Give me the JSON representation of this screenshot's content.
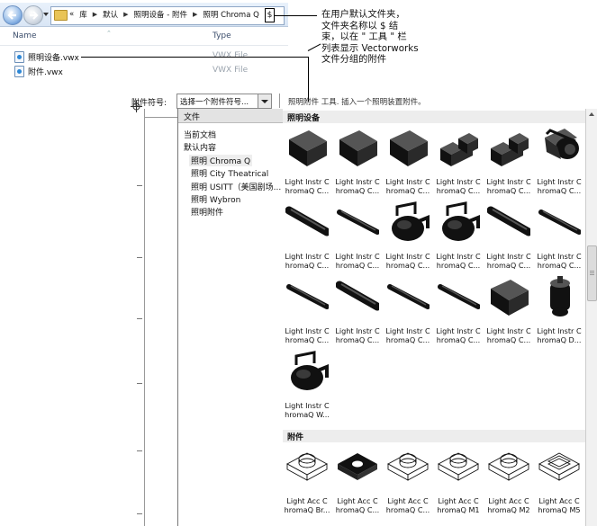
{
  "explorer": {
    "crumbs": [
      "«",
      "库",
      "默认",
      "照明设备 - 附件",
      "照明 Chroma Q"
    ],
    "columns": {
      "name": "Name",
      "type": "Type"
    },
    "files": [
      {
        "name": "照明设备.vwx",
        "type": "VWX File"
      },
      {
        "name": "附件.vwx",
        "type": "VWX File"
      }
    ]
  },
  "callout": {
    "lines": [
      "在用户默认文件夹，",
      "文件夹名称以 $ 结",
      "束，以在 \" 工具 \" 栏",
      "列表显示 Vectorworks",
      "文件分组的附件"
    ],
    "cursor_char": "$"
  },
  "toolbar": {
    "attach_label": "附件符号:",
    "select_value": "选择一个附件符号...",
    "hint": "照明附件 工具. 插入一个照明装置附件。"
  },
  "tree": {
    "header": "文件",
    "items": [
      {
        "label": "当前文档",
        "indent": 0,
        "selected": false
      },
      {
        "label": "默认内容",
        "indent": 0,
        "selected": false
      },
      {
        "label": "照明 Chroma Q",
        "indent": 1,
        "selected": true
      },
      {
        "label": "照明 City Theatrical",
        "indent": 1,
        "selected": false
      },
      {
        "label": "照明 USITT（美国剧场...",
        "indent": 1,
        "selected": false
      },
      {
        "label": "照明 Wybron",
        "indent": 1,
        "selected": false
      },
      {
        "label": "照明附件",
        "indent": 1,
        "selected": false
      }
    ]
  },
  "gallery": {
    "sections": [
      {
        "title": "照明设备",
        "tiles": [
          {
            "line1": "Light Instr C",
            "line2": "hromaQ C...",
            "icon": "box-fixture-icon"
          },
          {
            "line1": "Light Instr C",
            "line2": "hromaQ C...",
            "icon": "box-fixture-icon"
          },
          {
            "line1": "Light Instr C",
            "line2": "hromaQ C...",
            "icon": "box-fixture-icon"
          },
          {
            "line1": "Light Instr C",
            "line2": "hromaQ C...",
            "icon": "stepped-fixture-icon"
          },
          {
            "line1": "Light Instr C",
            "line2": "hromaQ C...",
            "icon": "stepped-fixture-icon"
          },
          {
            "line1": "Light Instr C",
            "line2": "hromaQ C...",
            "icon": "spot-fixture-icon"
          },
          {
            "line1": "Light Instr C",
            "line2": "hromaQ C...",
            "icon": "tube-fixture-icon"
          },
          {
            "line1": "Light Instr C",
            "line2": "hromaQ C...",
            "icon": "thin-tube-fixture-icon"
          },
          {
            "line1": "Light Instr C",
            "line2": "hromaQ C...",
            "icon": "yoke-fixture-icon"
          },
          {
            "line1": "Light Instr C",
            "line2": "hromaQ C...",
            "icon": "yoke-fixture-icon"
          },
          {
            "line1": "Light Instr C",
            "line2": "hromaQ C...",
            "icon": "tube-fixture-icon"
          },
          {
            "line1": "Light Instr C",
            "line2": "hromaQ C...",
            "icon": "thin-tube-fixture-icon"
          },
          {
            "line1": "Light Instr C",
            "line2": "hromaQ C...",
            "icon": "thin-tube-fixture-icon"
          },
          {
            "line1": "Light Instr C",
            "line2": "hromaQ C...",
            "icon": "tube-fixture-icon"
          },
          {
            "line1": "Light Instr C",
            "line2": "hromaQ C...",
            "icon": "thin-tube-fixture-icon"
          },
          {
            "line1": "Light Instr C",
            "line2": "hromaQ C...",
            "icon": "thin-tube-fixture-icon"
          },
          {
            "line1": "Light Instr C",
            "line2": "hromaQ C...",
            "icon": "box-fixture-icon"
          },
          {
            "line1": "Light Instr C",
            "line2": "hromaQ D...",
            "icon": "cylinder-fixture-icon"
          },
          {
            "line1": "Light Instr C",
            "line2": "hromaQ W...",
            "icon": "yoke-fixture-icon"
          }
        ]
      },
      {
        "title": "附件",
        "tiles": [
          {
            "line1": "Light Acc C",
            "line2": "hromaQ Br...",
            "icon": "wire-frame-accessory-icon"
          },
          {
            "line1": "Light Acc C",
            "line2": "hromaQ C...",
            "icon": "solid-frame-accessory-icon"
          },
          {
            "line1": "Light Acc C",
            "line2": "hromaQ C...",
            "icon": "wire-frame-accessory-icon"
          },
          {
            "line1": "Light Acc C",
            "line2": "hromaQ M1",
            "icon": "wire-frame-accessory-icon"
          },
          {
            "line1": "Light Acc C",
            "line2": "hromaQ M2",
            "icon": "wire-frame-accessory-icon"
          },
          {
            "line1": "Light Acc C",
            "line2": "hromaQ M5",
            "icon": "square-frame-accessory-icon"
          }
        ]
      }
    ]
  }
}
